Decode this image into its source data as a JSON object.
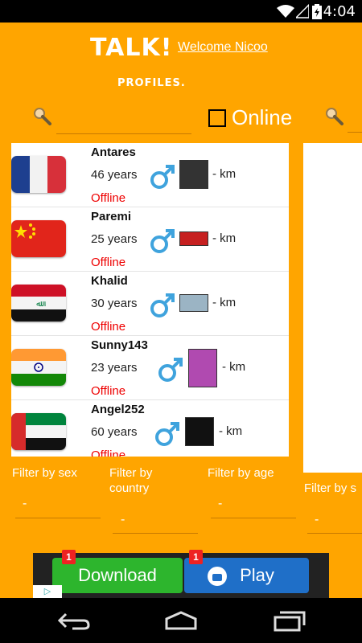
{
  "status_bar": {
    "time": "4:04"
  },
  "header": {
    "logo": "TALK!",
    "welcome": "Welcome Nicoo",
    "section_title": "PROFILES."
  },
  "search": {
    "value": "",
    "placeholder": "",
    "online_label": "Online",
    "online_checked": false
  },
  "profiles": [
    {
      "name": "Antares",
      "age": "46 years",
      "status": "Offline",
      "distance": "- km",
      "country_flag": "france-flag",
      "gender_icon": "male-icon"
    },
    {
      "name": "Paremi",
      "age": "25 years",
      "status": "Offline",
      "distance": "- km",
      "country_flag": "china-flag",
      "gender_icon": "male-icon"
    },
    {
      "name": "Khalid",
      "age": "30 years",
      "status": "Offline",
      "distance": "- km",
      "country_flag": "iraq-flag",
      "gender_icon": "male-icon"
    },
    {
      "name": "Sunny143",
      "age": "23 years",
      "status": "Offline",
      "distance": "- km",
      "country_flag": "india-flag",
      "gender_icon": "male-icon"
    },
    {
      "name": "Angel252",
      "age": "60 years",
      "status": "Offline",
      "distance": "- km",
      "country_flag": "uae-flag",
      "gender_icon": "male-icon"
    }
  ],
  "filters": {
    "sex": {
      "label": "Filter by sex",
      "value": "-"
    },
    "country": {
      "label": "Filter by country",
      "value": "-"
    },
    "age": {
      "label": "Filter by age",
      "value": "-"
    },
    "sex2": {
      "label": "Filter by s",
      "value": "-"
    }
  },
  "ad": {
    "download_label": "Download",
    "play_label": "Play",
    "badge": "1",
    "adchoices": "▷"
  },
  "colors": {
    "background": "#FFA500",
    "offline": "#E00000",
    "download": "#2db52d",
    "play": "#1f6fc8"
  }
}
